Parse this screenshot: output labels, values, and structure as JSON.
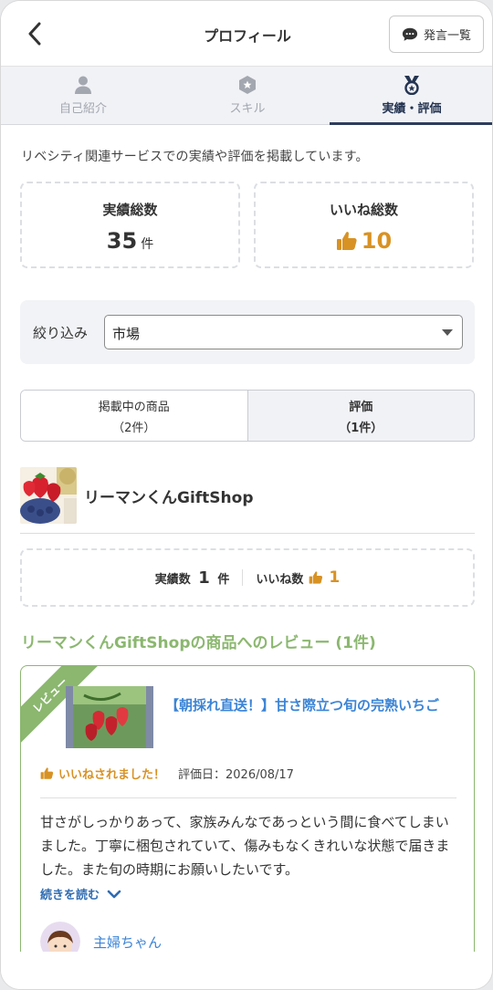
{
  "header": {
    "title": "プロフィール",
    "posts_button_label": "発言一覧"
  },
  "tabs": [
    {
      "label": "自己紹介",
      "icon": "person-icon",
      "active": false
    },
    {
      "label": "スキル",
      "icon": "hexagon-star-icon",
      "active": false
    },
    {
      "label": "実績・評価",
      "icon": "medal-icon",
      "active": true
    }
  ],
  "intro_text": "リベシティ関連サービスでの実績や評価を掲載しています。",
  "stats": {
    "total_label": "実績総数",
    "total_value": "35",
    "total_unit": "件",
    "likes_label": "いいね総数",
    "likes_value": "10"
  },
  "filter": {
    "label": "絞り込み",
    "selected": "市場"
  },
  "segments": [
    {
      "line1": "掲載中の商品",
      "line2": "（2件）",
      "active": false
    },
    {
      "line1": "評価",
      "line2": "（1件）",
      "active": true
    }
  ],
  "shop": {
    "name": "リーマンくんGiftShop",
    "achievements_label": "実績数",
    "achievements_value": "1",
    "achievements_unit": "件",
    "likes_label": "いいね数",
    "likes_value": "1"
  },
  "review_heading": "リーマンくんGiftShopの商品へのレビュー (1件)",
  "review": {
    "ribbon": "レビュー",
    "product_title": "【朝採れ直送！】甘さ際立つ旬の完熟いちご",
    "liked_text": "いいねされました！",
    "date_text": "評価日：2026/08/17",
    "body": "甘さがしっかりあって、家族みんなであっという間に食べてしまいました。丁寧に梱包されていて、傷みもなくきれいな状態で届きました。また旬の時期にお願いしたいです。",
    "read_more": "続きを読む",
    "reviewer_name": "主婦ちゃん"
  },
  "colors": {
    "accent_green": "#8bb76f",
    "like_orange": "#d89224",
    "link_blue": "#3b84d6",
    "navy": "#2d3d5c"
  }
}
